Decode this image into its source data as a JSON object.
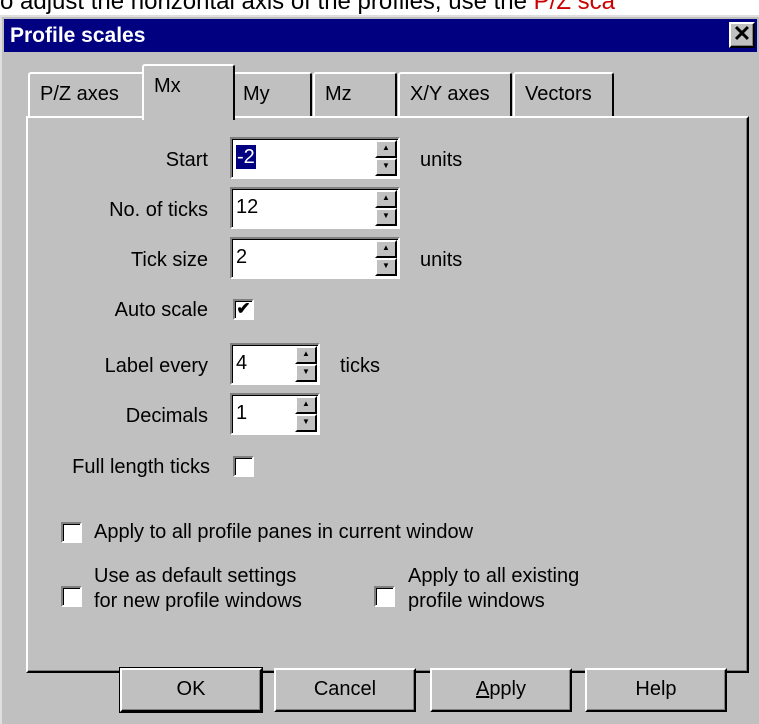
{
  "doc": {
    "prefix": "o adjust the horizontal axis of the profiles, use the ",
    "highlight": "P/Z sca"
  },
  "dialog": {
    "title": "Profile scales",
    "close_glyph": "✕"
  },
  "tabs": [
    {
      "label": "P/Z axes",
      "active": false
    },
    {
      "label": "Mx",
      "active": true
    },
    {
      "label": "My",
      "active": false
    },
    {
      "label": "Mz",
      "active": false
    },
    {
      "label": "X/Y axes",
      "active": false
    },
    {
      "label": "Vectors",
      "active": false
    }
  ],
  "fields": {
    "start": {
      "label": "Start",
      "value": "-2",
      "unit": "units"
    },
    "ticks": {
      "label": "No. of ticks",
      "value": "12"
    },
    "tick_size": {
      "label": "Tick size",
      "value": "2",
      "unit": "units"
    },
    "auto_scale": {
      "label": "Auto scale",
      "checked": true,
      "mark": "✔"
    },
    "label_every": {
      "label": "Label every",
      "value": "4",
      "unit": "ticks"
    },
    "decimals": {
      "label": "Decimals",
      "value": "1"
    },
    "full_length": {
      "label": "Full length ticks",
      "checked": false
    }
  },
  "options": {
    "apply_all_panes": "Apply to all profile panes in current window",
    "default_line1": "Use as default settings",
    "default_line2": "for new profile windows",
    "existing_line1": "Apply to all existing",
    "existing_line2": "profile windows"
  },
  "buttons": {
    "ok": "OK",
    "cancel": "Cancel",
    "apply_prefix": "",
    "apply_underline": "A",
    "apply_rest": "pply",
    "help": "Help"
  },
  "icons": {
    "spin_up": "▲",
    "spin_down": "▼"
  },
  "colors": {
    "titlebar": "#000080",
    "face": "#c0c0c0",
    "doc_highlight": "#cc0000"
  }
}
